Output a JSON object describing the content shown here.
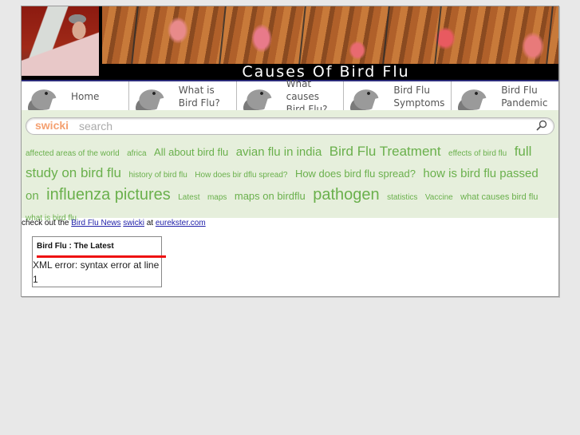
{
  "header": {
    "site_title": "Causes Of Bird Flu",
    "banner_images": [
      "scientist-microscope-photo",
      "chickens-photo"
    ]
  },
  "nav": {
    "items": [
      {
        "label": "Home",
        "icon": "hen-head-icon"
      },
      {
        "label": "What is\nBird Flu?",
        "icon": "hen-head-icon"
      },
      {
        "label": "What causes\nBird Flu?",
        "icon": "hen-head-icon"
      },
      {
        "label": "Bird Flu\nSymptoms",
        "icon": "hen-head-icon"
      },
      {
        "label": "Bird Flu\nPandemic",
        "icon": "hen-head-icon"
      }
    ]
  },
  "swicki": {
    "brand": "swicki",
    "search_placeholder": "search",
    "search_value": "",
    "search_icon": "magnifier-icon",
    "brand_color": "#f4a070",
    "tag_color": "#6ab04c",
    "tags": [
      {
        "label": "affected areas of the world",
        "size": 1
      },
      {
        "label": "africa",
        "size": 1
      },
      {
        "label": "All about bird flu",
        "size": 3
      },
      {
        "label": "avian flu in india",
        "size": 4
      },
      {
        "label": "Bird Flu Treatment",
        "size": 5
      },
      {
        "label": "effects of bird flu",
        "size": 1
      },
      {
        "label": "full study on bird flu",
        "size": 5
      },
      {
        "label": "history of bird flu",
        "size": 1
      },
      {
        "label": "How does bir dflu spread?",
        "size": 1
      },
      {
        "label": "How does bird flu spread?",
        "size": 3
      },
      {
        "label": "how is bird flu passed on",
        "size": 4
      },
      {
        "label": "influenza pictures",
        "size": 6
      },
      {
        "label": "Latest",
        "size": 1
      },
      {
        "label": "maps",
        "size": 1
      },
      {
        "label": "maps on birdflu",
        "size": 3
      },
      {
        "label": "pathogen",
        "size": 6
      },
      {
        "label": "statistics",
        "size": 1
      },
      {
        "label": "Vaccine",
        "size": 1
      },
      {
        "label": "what causes bird flu",
        "size": 2
      },
      {
        "label": "what is bird flu",
        "size": 1
      }
    ]
  },
  "credit": {
    "prefix": "check out the ",
    "link1": "Bird Flu News",
    "space": " ",
    "link2": "swicki",
    "middle": " at ",
    "link3": "eurekster.com"
  },
  "feed": {
    "title": "Bird Flu : The Latest",
    "body": "XML error: syntax error at line 1",
    "rule_color": "#ee1111"
  }
}
